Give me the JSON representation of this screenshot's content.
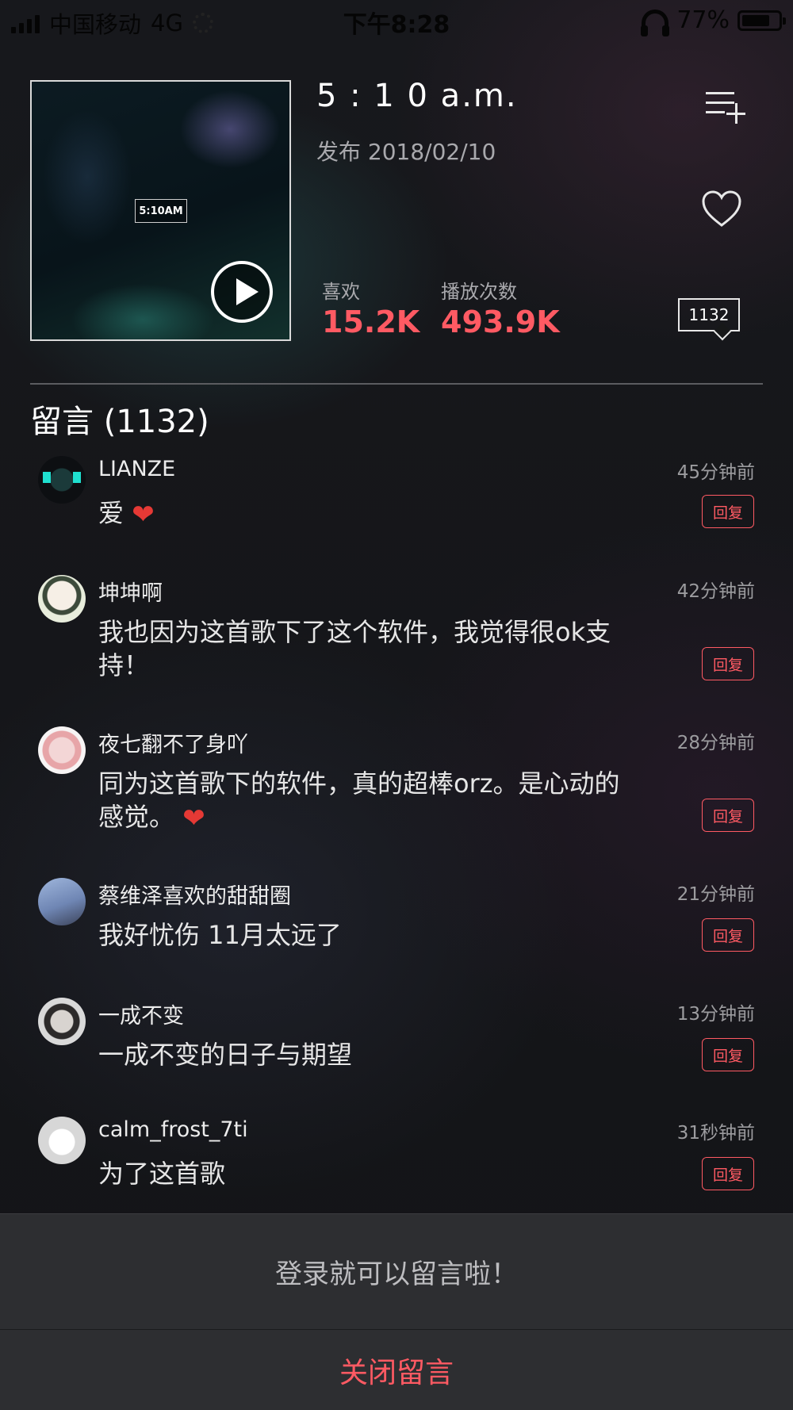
{
  "status_bar": {
    "carrier": "中国移动",
    "network": "4G",
    "time": "下午8:28",
    "battery": "77%"
  },
  "song": {
    "title": "5 : 1 0 a.m.",
    "release": "发布 2018/02/10",
    "cover_label": "5:10AM",
    "likes_label": "喜欢",
    "likes_value": "15.2K",
    "plays_label": "播放次数",
    "plays_value": "493.9K",
    "comment_count": "1132"
  },
  "comments_header": "留言 (1132)",
  "comments": [
    {
      "user": "LIANZE",
      "time": "45分钟前",
      "text": "爱",
      "heart": "❤",
      "reply": "回复"
    },
    {
      "user": "坤坤啊",
      "time": "42分钟前",
      "text": "我也因为这首歌下了这个软件，我觉得很ok支持！",
      "reply": "回复"
    },
    {
      "user": "夜七翻不了身吖",
      "time": "28分钟前",
      "text": "同为这首歌下的软件，真的超棒orz。是心动的感觉。",
      "heart": "❤",
      "reply": "回复"
    },
    {
      "user": "蔡维泽喜欢的甜甜圈",
      "time": "21分钟前",
      "text": "我好忧伤 11月太远了",
      "reply": "回复"
    },
    {
      "user": "一成不变",
      "time": "13分钟前",
      "text": "一成不变的日子与期望",
      "reply": "回复"
    },
    {
      "user": "calm_frost_7ti",
      "time": "31秒钟前",
      "text": "为了这首歌",
      "reply": "回复"
    }
  ],
  "sheet": {
    "login_prompt": "登录就可以留言啦！",
    "close": "关闭留言"
  },
  "colors": {
    "accent": "#ff5a63",
    "background": "#141517",
    "sheet": "#2d2e31"
  },
  "icons": [
    "signal-icon",
    "loading-icon",
    "headphone-icon",
    "battery-icon",
    "play-icon",
    "add-to-playlist-icon",
    "heart-icon",
    "comment-count-icon"
  ]
}
